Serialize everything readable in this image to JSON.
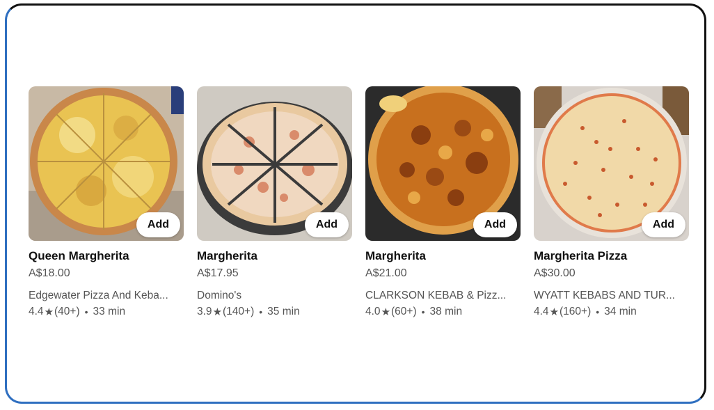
{
  "cards": [
    {
      "title": "Queen Margherita",
      "price": "A$18.00",
      "store": "Edgewater Pizza And Keba...",
      "rating": "4.4",
      "reviews": "(40+)",
      "time": "33 min",
      "add_label": "Add",
      "star_icon": "star-icon",
      "dot": "•"
    },
    {
      "title": "Margherita",
      "price": "A$17.95",
      "store": "Domino's",
      "rating": "3.9",
      "reviews": "(140+)",
      "time": "35 min",
      "add_label": "Add",
      "star_icon": "star-icon",
      "dot": "•"
    },
    {
      "title": "Margherita",
      "price": "A$21.00",
      "store": "CLARKSON KEBAB & Pizz...",
      "rating": "4.0",
      "reviews": "(60+)",
      "time": "38 min",
      "add_label": "Add",
      "star_icon": "star-icon",
      "dot": "•"
    },
    {
      "title": "Margherita Pizza",
      "price": "A$30.00",
      "store": "WYATT KEBABS AND TUR...",
      "rating": "4.4",
      "reviews": "(160+)",
      "time": "34 min",
      "add_label": "Add",
      "star_icon": "star-icon",
      "dot": "•"
    }
  ],
  "colors": {
    "frame_top": "#111111",
    "frame_bottom": "#2f6fc0",
    "text_primary": "#111111",
    "text_secondary": "#555555"
  }
}
